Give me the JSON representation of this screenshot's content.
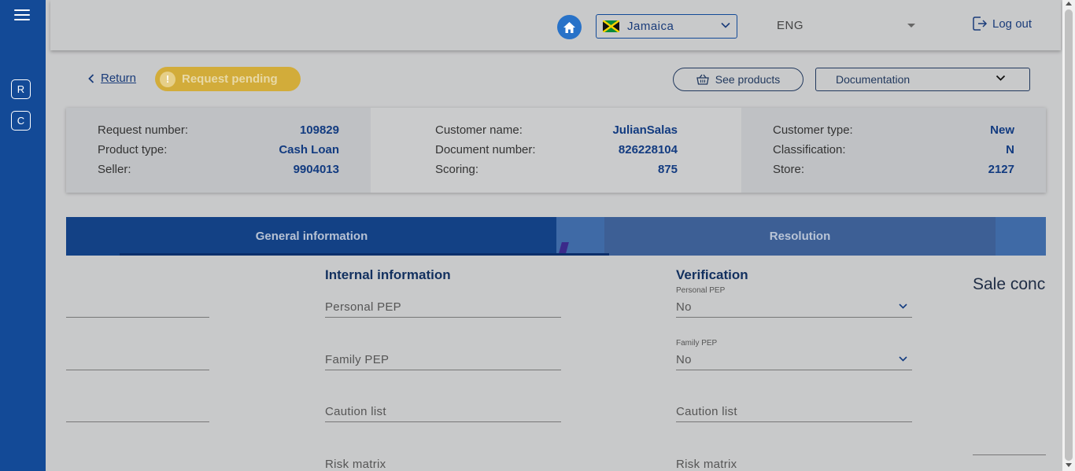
{
  "sidebar": {
    "menu_icon": "hamburger-menu-icon",
    "buttons": [
      {
        "label": "R"
      },
      {
        "label": "C"
      }
    ]
  },
  "topbar": {
    "home_icon": "home-icon",
    "country": {
      "label": "Jamaica",
      "flag": "jamaica-flag-icon"
    },
    "language": {
      "label": "ENG"
    },
    "logout_label": "Log out"
  },
  "actions": {
    "return_label": "Return",
    "status_badge": "Request pending",
    "status_icon": "!",
    "see_products_label": "See products",
    "documentation_label": "Documentation"
  },
  "summary": {
    "col1": [
      {
        "key": "Request number:",
        "value": "109829"
      },
      {
        "key": "Product type:",
        "value": "Cash Loan"
      },
      {
        "key": "Seller:",
        "value": "9904013"
      }
    ],
    "col2": [
      {
        "key": "Customer name:",
        "value": "JulianSalas"
      },
      {
        "key": "Document number:",
        "value": "826228104"
      },
      {
        "key": "Scoring:",
        "value": "875"
      }
    ],
    "col3": [
      {
        "key": "Customer type:",
        "value": "New"
      },
      {
        "key": "Classification:",
        "value": "N"
      },
      {
        "key": "Store:",
        "value": "2127"
      }
    ]
  },
  "tabs": {
    "general": "General information",
    "resolution": "Resolution"
  },
  "internal": {
    "title": "Internal information",
    "fields": [
      "Personal PEP",
      "Family PEP",
      "Caution list",
      "Risk matrix"
    ]
  },
  "verification": {
    "title": "Verification",
    "personal_pep": {
      "label": "Personal PEP",
      "value": "No"
    },
    "family_pep": {
      "label": "Family PEP",
      "value": "No"
    },
    "caution_list": "Caution list",
    "risk_matrix": "Risk matrix"
  },
  "sale_conditions_title": "Sale conc",
  "colors": {
    "sidebar": "#134a97",
    "primary": "#134185",
    "badge": "#d2ac3a"
  }
}
